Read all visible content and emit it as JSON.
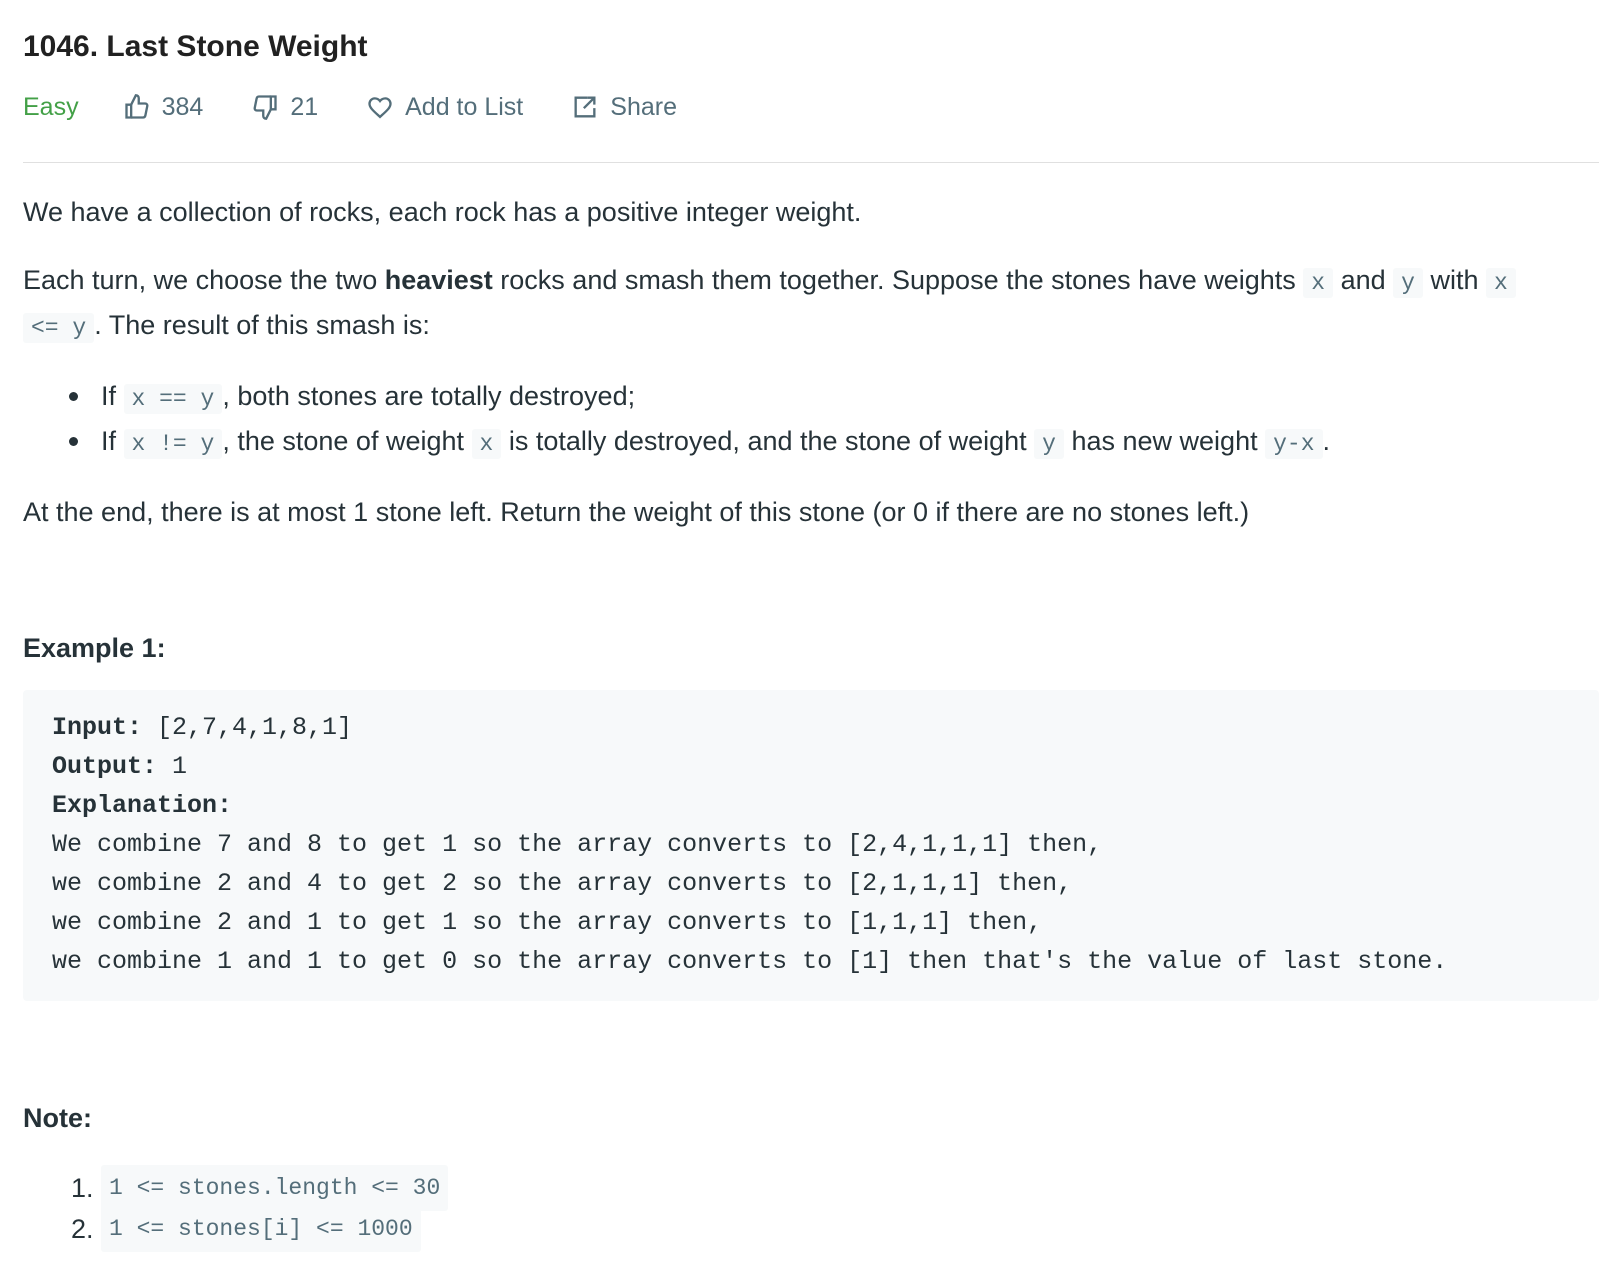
{
  "problem": {
    "title": "1046. Last Stone Weight",
    "difficulty": "Easy",
    "likes": "384",
    "dislikes": "21",
    "add_to_list_label": "Add to List",
    "share_label": "Share"
  },
  "description": {
    "p1": "We have a collection of rocks, each rock has a positive integer weight.",
    "p2_part1": "Each turn, we choose the two ",
    "p2_bold": "heaviest",
    "p2_part2": " rocks and smash them together.  Suppose the stones have weights ",
    "p2_code_x": "x",
    "p2_and": " and ",
    "p2_code_y": "y",
    "p2_with": " with ",
    "p2_code_x2": "x",
    "p2_code_le": "<= y",
    "p2_part3": ".  The result of this smash is:",
    "rule1_if": "If ",
    "rule1_code": "x == y",
    "rule1_text": ", both stones are totally destroyed;",
    "rule2_if": "If ",
    "rule2_code": "x != y",
    "rule2_text1": ", the stone of weight ",
    "rule2_code_x": "x",
    "rule2_text2": " is totally destroyed, and the stone of weight ",
    "rule2_code_y": "y",
    "rule2_text3": " has new weight ",
    "rule2_code_yx": "y-x",
    "rule2_text4": ".",
    "p3": "At the end, there is at most 1 stone left.  Return the weight of this stone (or 0 if there are no stones left.)"
  },
  "example": {
    "heading": "Example 1:",
    "input_label": "Input:",
    "input_value": " [2,7,4,1,8,1]",
    "output_label": "Output:",
    "output_value": " 1",
    "explanation_label": "Explanation:",
    "lines": [
      "We combine 7 and 8 to get 1 so the array converts to [2,4,1,1,1] then,",
      "we combine 2 and 4 to get 2 so the array converts to [2,1,1,1] then,",
      "we combine 2 and 1 to get 1 so the array converts to [1,1,1] then,",
      "we combine 1 and 1 to get 0 so the array converts to [1] then that's the value of last stone."
    ]
  },
  "note": {
    "heading": "Note:",
    "items": [
      {
        "num": "1.",
        "code": "1 <= stones.length <= 30"
      },
      {
        "num": "2.",
        "code": "1 <= stones[i] <= 1000"
      }
    ]
  },
  "colors": {
    "difficulty_easy": "#43a047",
    "text": "#263238",
    "muted": "#546e7a",
    "code_bg": "#f7f9fa"
  },
  "icons": {
    "like": "thumbs-up-icon",
    "dislike": "thumbs-down-icon",
    "favorite": "heart-icon",
    "share": "share-icon"
  }
}
